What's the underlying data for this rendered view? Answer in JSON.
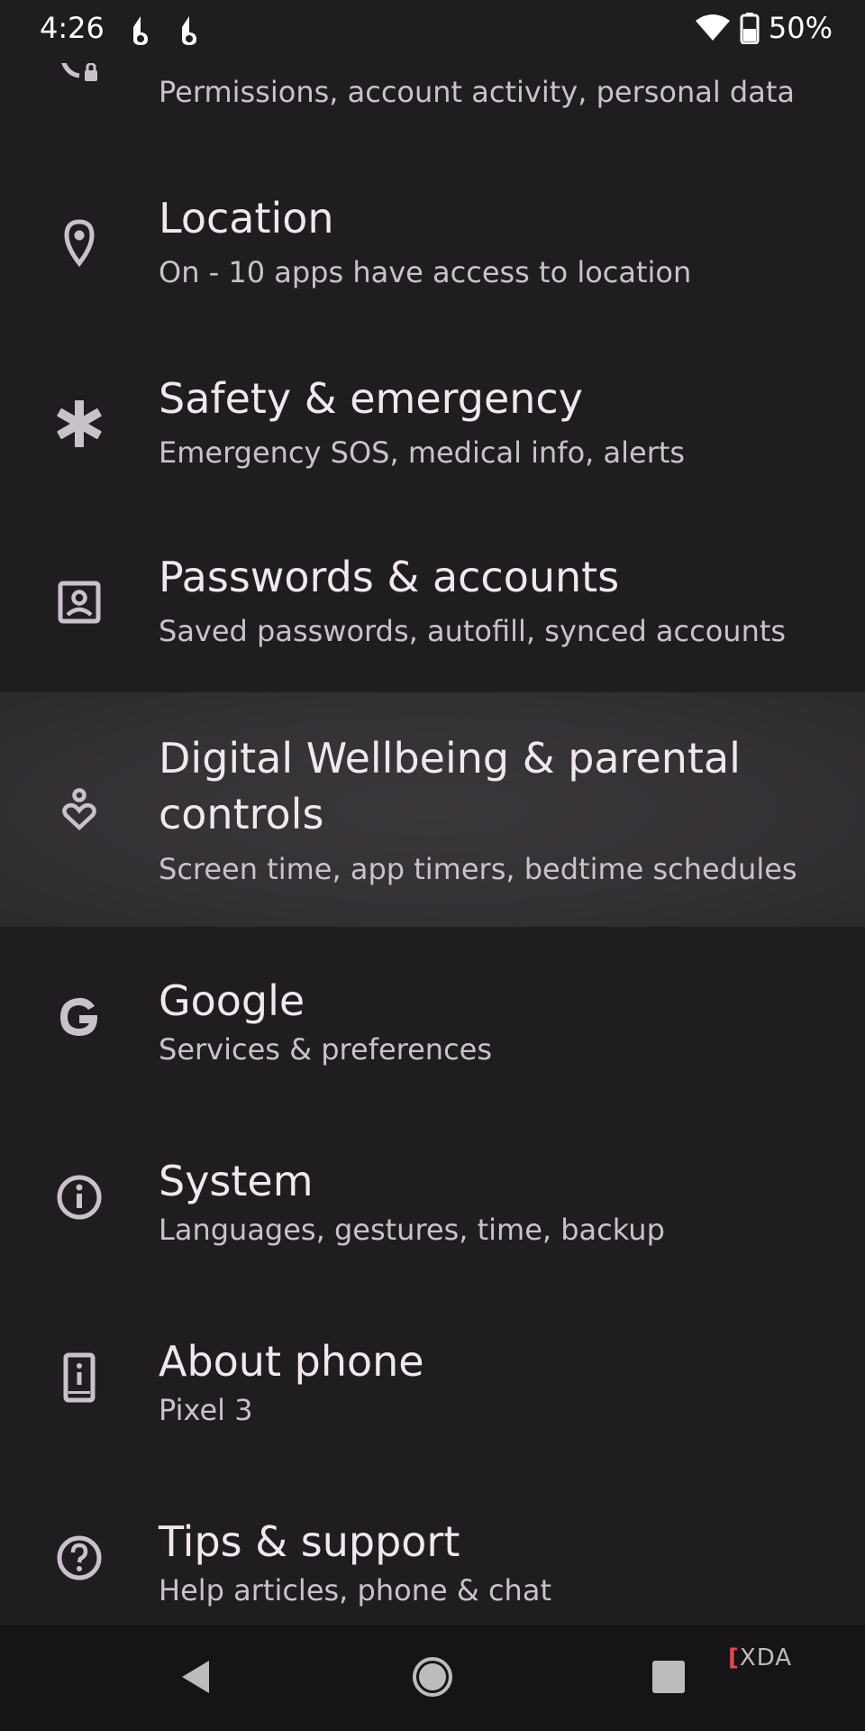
{
  "status_bar": {
    "time": "4:26",
    "battery_percent": "50%",
    "icons": [
      "notification-app-icon",
      "notification-app-icon",
      "wifi-icon",
      "battery-icon"
    ]
  },
  "settings": {
    "items": [
      {
        "title": "",
        "subtitle": "Permissions, account activity, personal data",
        "icon": "privacy-lock-icon"
      },
      {
        "title": "Location",
        "subtitle": "On - 10 apps have access to location",
        "icon": "location-pin-icon"
      },
      {
        "title": "Safety & emergency",
        "subtitle": "Emergency SOS, medical info, alerts",
        "icon": "asterisk-medical-icon"
      },
      {
        "title": "Passwords & accounts",
        "subtitle": "Saved passwords, autofill, synced accounts",
        "icon": "account-box-icon"
      },
      {
        "title": "Digital Wellbeing & parental controls",
        "subtitle": "Screen time, app timers, bedtime schedules",
        "icon": "wellbeing-heart-icon"
      },
      {
        "title": "Google",
        "subtitle": "Services & preferences",
        "icon": "google-g-icon"
      },
      {
        "title": "System",
        "subtitle": "Languages, gestures, time, backup",
        "icon": "info-icon"
      },
      {
        "title": "About phone",
        "subtitle": "Pixel 3",
        "icon": "phone-info-icon"
      },
      {
        "title": "Tips & support",
        "subtitle": "Help articles, phone & chat",
        "icon": "help-icon"
      }
    ]
  },
  "nav_bar": {
    "buttons": [
      "back-icon",
      "home-icon",
      "recents-icon"
    ]
  },
  "watermark": {
    "bracket": "[",
    "text": "XDA"
  }
}
